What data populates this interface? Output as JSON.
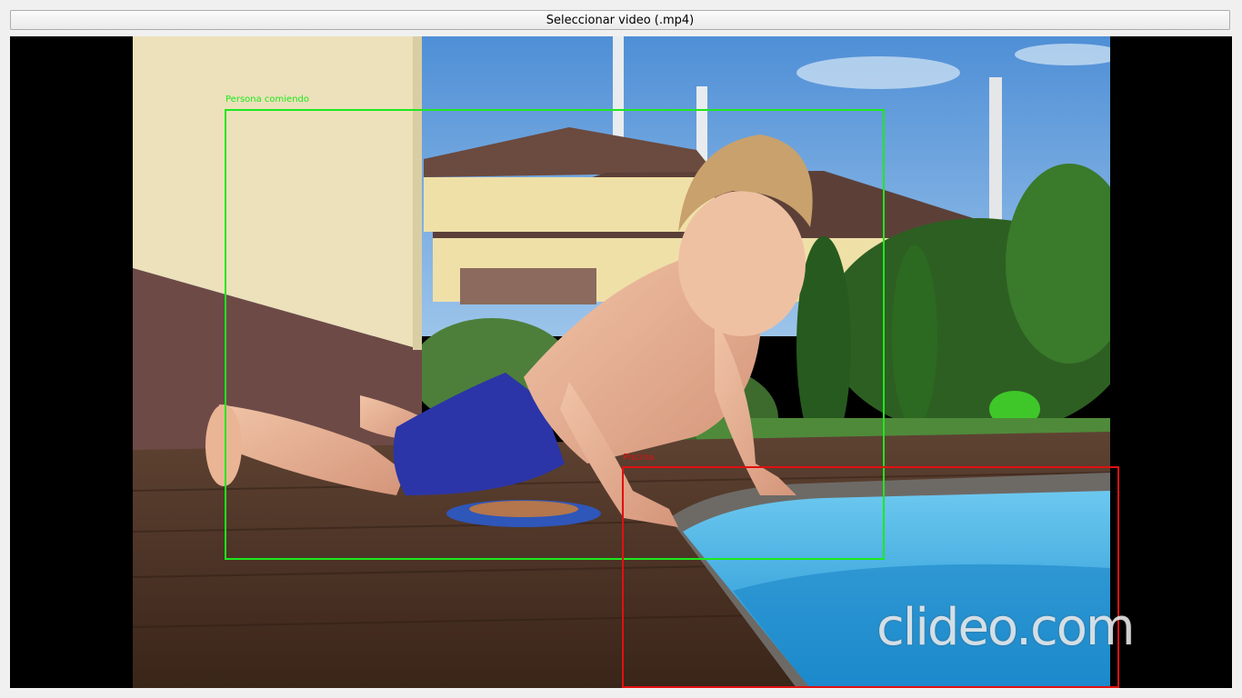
{
  "toolbar": {
    "select_video_label": "Seleccionar video (.mp4)"
  },
  "video": {
    "detections": [
      {
        "label": "Persona comiendo",
        "color": "#1ee81e"
      },
      {
        "label": "Piscina",
        "color": "#e01010"
      }
    ],
    "watermark": "clideo.com"
  }
}
